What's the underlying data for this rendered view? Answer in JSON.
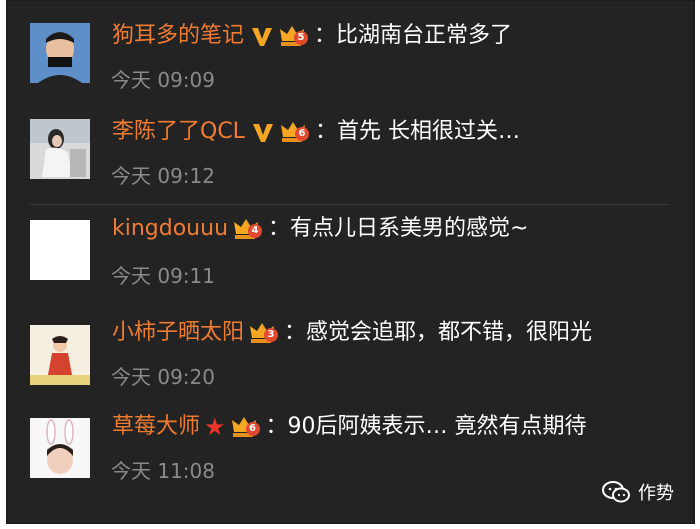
{
  "comments": [
    {
      "username": "狗耳多的笔记",
      "colon": "：",
      "text": "比湖南台正常多了",
      "time": "今天 09:09",
      "verified": true,
      "level": "5"
    },
    {
      "username": "李陈了了QCL",
      "colon": "：",
      "text": "首先 长相很过关…",
      "time": "今天 09:12",
      "verified": true,
      "level": "6"
    },
    {
      "username": "kingdouuu",
      "colon": "：",
      "text": "有点儿日系美男的感觉~",
      "time": "今天 09:11",
      "verified": false,
      "level": "4"
    },
    {
      "username": "小柿子晒太阳",
      "colon": "：",
      "text": "感觉会追耶，都不错，很阳光",
      "time": "今天 09:20",
      "verified": false,
      "level": "3"
    },
    {
      "username": "草莓大师",
      "colon": "：",
      "text": "90后阿姨表示… 竟然有点期待",
      "time": "今天 11:08",
      "verified": false,
      "level": "6",
      "star": true
    }
  ],
  "watermark": {
    "text": "作势",
    "icon": "wechat-icon"
  },
  "colors": {
    "username": "#f07c32",
    "background": "#232323",
    "time": "#8a8a8a",
    "verified": "#f5a623"
  }
}
